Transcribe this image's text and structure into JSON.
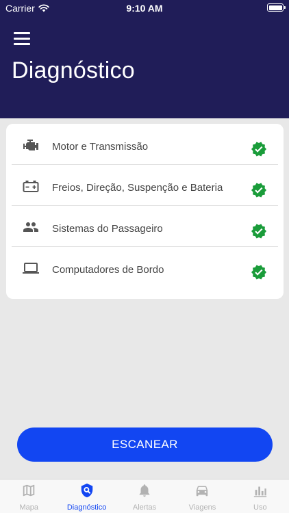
{
  "status_bar": {
    "carrier": "Carrier",
    "time": "9:10 AM"
  },
  "header": {
    "title": "Diagnóstico"
  },
  "systems": [
    {
      "label": "Motor e Transmissão",
      "icon": "engine-icon",
      "status": "ok"
    },
    {
      "label": "Freios, Direção, Suspenção e Bateria",
      "icon": "battery-icon",
      "status": "ok"
    },
    {
      "label": "Sistemas do Passageiro",
      "icon": "people-icon",
      "status": "ok"
    },
    {
      "label": "Computadores de Bordo",
      "icon": "computer-icon",
      "status": "ok"
    }
  ],
  "scan_button": {
    "label": "ESCANEAR"
  },
  "tabs": [
    {
      "label": "Mapa",
      "icon": "map-icon",
      "active": false
    },
    {
      "label": "Diagnóstico",
      "icon": "diagnostic-shield-icon",
      "active": true
    },
    {
      "label": "Alertas",
      "icon": "bell-icon",
      "active": false
    },
    {
      "label": "Viagens",
      "icon": "car-icon",
      "active": false
    },
    {
      "label": "Uso",
      "icon": "bar-chart-icon",
      "active": false
    }
  ],
  "colors": {
    "header_bg": "#201d58",
    "accent": "#1246f2",
    "status_ok": "#1a9c3a",
    "inactive_tab": "#b2b2b2"
  }
}
